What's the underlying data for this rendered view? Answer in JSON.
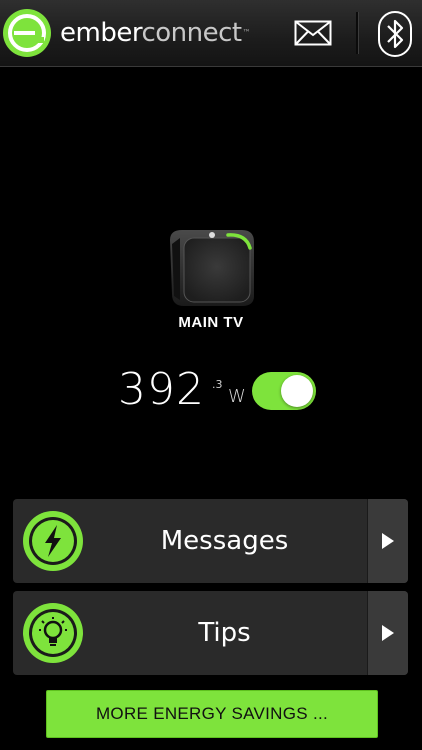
{
  "header": {
    "brand_part1": "ember",
    "brand_part2": "connect",
    "trademark": "™",
    "logo_icon": "ember-e-logo-icon",
    "mail_icon": "envelope-icon",
    "bluetooth_icon": "bluetooth-icon"
  },
  "device": {
    "name": "MAIN TV",
    "icon": "smart-plug-icon",
    "power_whole": "392",
    "power_decimal": ".3",
    "power_unit": "W",
    "switch_on": true
  },
  "rows": {
    "messages": {
      "label": "Messages",
      "icon": "lightning-bolt-icon"
    },
    "tips": {
      "label": "Tips",
      "icon": "lightbulb-icon"
    }
  },
  "bottom_button": {
    "label": "MORE ENERGY SAVINGS ..."
  },
  "colors": {
    "accent": "#7ee33c",
    "background": "#000000",
    "row_background": "#2a2a2a"
  }
}
